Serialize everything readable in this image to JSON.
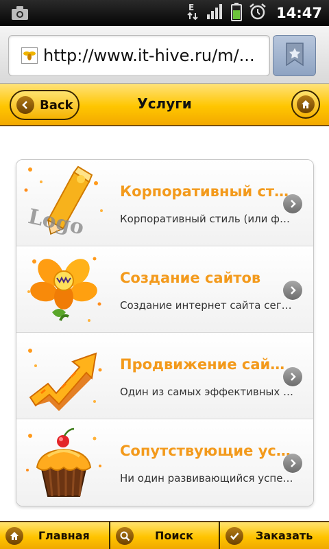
{
  "status_bar": {
    "time": "14:47",
    "network_letter": "E",
    "icons": [
      "screenshot-icon",
      "network-e-icon",
      "signal-icon",
      "battery-icon",
      "alarm-icon"
    ]
  },
  "browser": {
    "url": "http://www.it-hive.ru/m/...",
    "icons": [
      "favicon-icon",
      "bookmark-star-icon"
    ]
  },
  "header": {
    "back_label": "Back",
    "title": "Услуги",
    "icons": [
      "back-arrow-icon",
      "home-icon"
    ]
  },
  "services": [
    {
      "title": "Корпоративный стиль",
      "description": "Корпоративный стиль (или фирменный стиль)",
      "icon": "logo-pencil-icon"
    },
    {
      "title": "Создание сайтов",
      "description": "Создание интернет сайта сегодня",
      "icon": "flower-icon"
    },
    {
      "title": "Продвижение сайтов",
      "description": "Один из самых эффективных способов",
      "icon": "growth-arrow-icon"
    },
    {
      "title": "Сопутствующие услуги",
      "description": "Ни один развивающийся успешный бизнес",
      "icon": "cupcake-icon"
    }
  ],
  "tabs": [
    {
      "label": "Главная",
      "icon": "home-icon"
    },
    {
      "label": "Поиск",
      "icon": "search-icon"
    },
    {
      "label": "Заказать",
      "icon": "check-icon"
    }
  ],
  "colors": {
    "accent": "#ffc400",
    "title_orange": "#f39a1c",
    "status_bar": "#000000"
  }
}
